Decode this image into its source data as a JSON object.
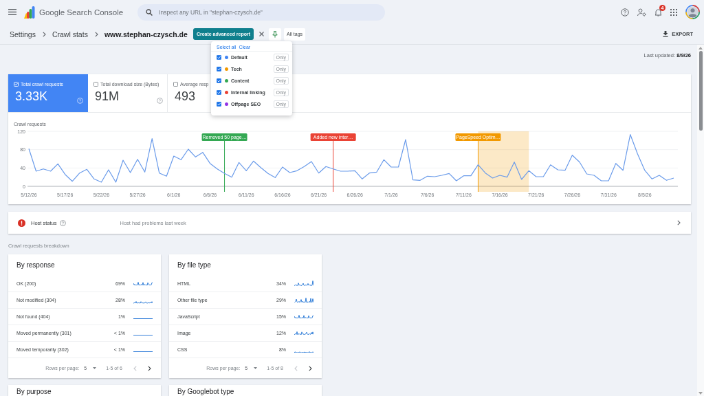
{
  "header": {
    "title": "Google Search Console",
    "search": {
      "placeholder": "Inspect any URL in \"stephan-czysch.de\""
    },
    "notification_count": "4"
  },
  "breadcrumbs": [
    "Settings",
    "Crawl stats",
    "www.stephan-czysch.de"
  ],
  "toolbar": {
    "create_button": "Create advanced report",
    "tags_button": "All tags",
    "export_button": "EXPORT"
  },
  "tag_menu": {
    "select_all": "Select all",
    "clear": "Clear",
    "tags": [
      {
        "label": "Default",
        "color": "#4285f4",
        "checked": true,
        "only": "Only"
      },
      {
        "label": "Tech",
        "color": "#f29900",
        "checked": true,
        "only": "Only"
      },
      {
        "label": "Content",
        "color": "#34a853",
        "checked": true,
        "only": "Only"
      },
      {
        "label": "Internal linking",
        "color": "#ea4335",
        "checked": true,
        "only": "Only"
      },
      {
        "label": "Offpage SEO",
        "color": "#9334e6",
        "checked": true,
        "only": "Only"
      }
    ]
  },
  "last_updated": "Last updated: **8/9/26**",
  "metrics": [
    {
      "label": "Total crawl requests",
      "value": "3.33K",
      "selected": true,
      "help_icon": true
    },
    {
      "label": "Total download size (Bytes)",
      "value": "91M",
      "selected": false,
      "help_icon": true
    },
    {
      "label": "Average resp",
      "value": "493",
      "selected": false
    }
  ],
  "chart": {
    "chart_data": {
      "type": "line",
      "ylabel": "Crawl requests",
      "ylim": [
        0,
        120
      ],
      "yticks": [
        0,
        40,
        80,
        120
      ],
      "categories": [
        "5/12/26",
        null,
        null,
        null,
        null,
        "5/17/26",
        null,
        null,
        null,
        null,
        "5/22/26",
        null,
        null,
        null,
        null,
        "5/27/26",
        null,
        null,
        null,
        null,
        "6/1/26",
        null,
        null,
        null,
        null,
        "6/6/26",
        null,
        null,
        null,
        null,
        "6/11/26",
        null,
        null,
        null,
        null,
        "6/16/26",
        null,
        null,
        null,
        null,
        "6/21/26",
        null,
        null,
        null,
        null,
        "6/26/26",
        null,
        null,
        null,
        null,
        "7/1/26",
        null,
        null,
        null,
        null,
        "7/6/26",
        null,
        null,
        null,
        null,
        "7/11/26",
        null,
        null,
        null,
        null,
        "7/16/26",
        null,
        null,
        null,
        null,
        "7/21/26",
        null,
        null,
        null,
        null,
        "7/26/26",
        null,
        null,
        null,
        null,
        "7/31/26",
        null,
        null,
        null,
        null,
        "8/5/26",
        null,
        null,
        null,
        null
      ],
      "series": [
        {
          "color": "#6a9bea",
          "values": [
            82,
            33,
            38,
            33,
            49,
            26,
            11,
            29,
            37,
            16,
            9,
            36,
            9,
            57,
            30,
            59,
            31,
            104,
            29,
            22,
            66,
            58,
            81,
            64,
            74,
            50,
            38,
            28,
            20,
            52,
            34,
            55,
            41,
            28,
            19,
            42,
            30,
            34,
            43,
            54,
            29,
            43,
            38,
            33,
            33,
            34,
            16,
            29,
            31,
            58,
            42,
            42,
            102,
            14,
            13,
            22,
            21,
            24,
            28,
            12,
            23,
            23,
            47,
            29,
            18,
            24,
            20,
            53,
            15,
            34,
            21,
            21,
            47,
            36,
            35,
            68,
            53,
            27,
            24,
            12,
            12,
            50,
            35,
            113,
            71,
            35,
            16,
            24,
            13,
            18
          ]
        }
      ]
    },
    "markers": [
      {
        "kind": "line",
        "label": "Removed 50 page…",
        "color": "#34a853"
      },
      {
        "kind": "line",
        "label": "Added new inter…",
        "color": "#ea4335"
      },
      {
        "kind": "band",
        "label": "PageSpeed Optim…",
        "color": "#f29900"
      }
    ]
  },
  "host_status": {
    "label": "Host status",
    "message": "Host had problems last week"
  },
  "breakdown": {
    "heading": "Crawl requests breakdown",
    "cards": [
      {
        "title": "By response",
        "rows": [
          {
            "label": "OK (200)",
            "share": "69%"
          },
          {
            "label": "Not modified (304)",
            "share": "28%"
          },
          {
            "label": "Not found (404)",
            "share": "1%"
          },
          {
            "label": "Moved permanently (301)",
            "share": "< 1%"
          },
          {
            "label": "Moved temporarily (302)",
            "share": "< 1%"
          }
        ],
        "rows_per_page_label": "Rows per page:",
        "rows_per_page": "5",
        "range": "1-5 of 6",
        "prev_disabled": true,
        "next_disabled": false
      },
      {
        "title": "By file type",
        "rows": [
          {
            "label": "HTML",
            "share": "34%"
          },
          {
            "label": "Other file type",
            "share": "29%"
          },
          {
            "label": "JavaScript",
            "share": "15%"
          },
          {
            "label": "Image",
            "share": "12%"
          },
          {
            "label": "CSS",
            "share": "8%"
          }
        ],
        "rows_per_page_label": "Rows per page:",
        "rows_per_page": "5",
        "range": "1-5 of 8",
        "prev_disabled": true,
        "next_disabled": false
      }
    ],
    "more_cards": [
      "By purpose",
      "By Googlebot type"
    ]
  }
}
